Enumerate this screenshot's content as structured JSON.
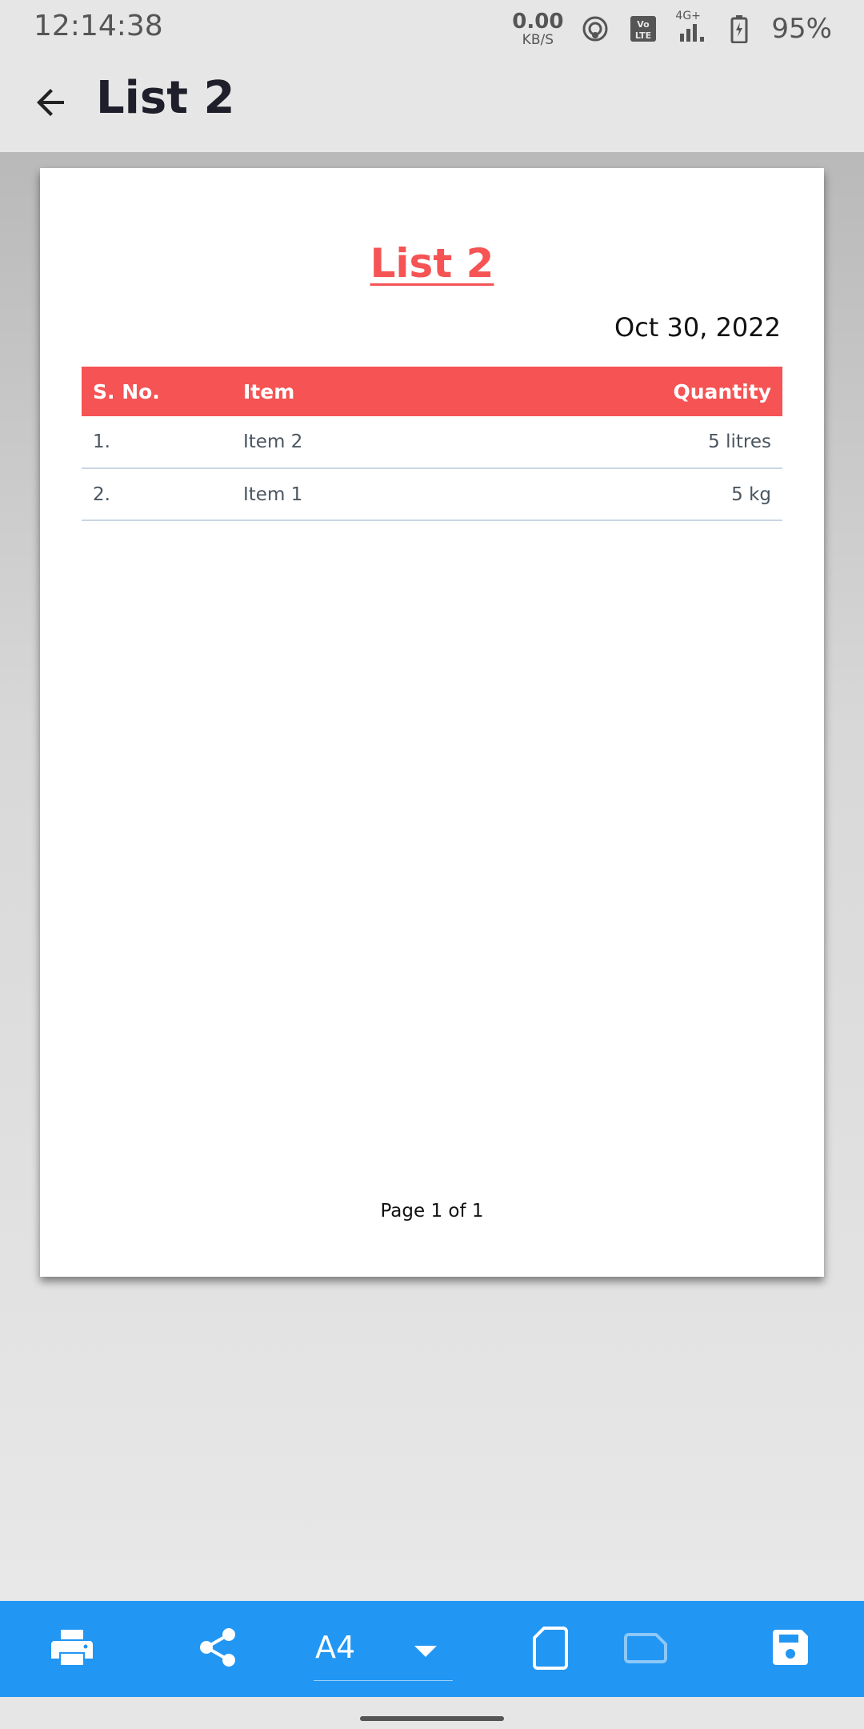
{
  "status_bar": {
    "time": "12:14:38",
    "net_speed_value": "0.00",
    "net_speed_unit": "KB/S",
    "network_label": "4G+",
    "battery": "95%",
    "icons": [
      "hotspot-icon",
      "volte-icon",
      "signal-icon",
      "battery-icon"
    ]
  },
  "app_bar": {
    "title": "List 2",
    "back_icon": "arrow-back-icon"
  },
  "document": {
    "title": "List 2",
    "date": "Oct 30, 2022",
    "accent_color": "#f55354",
    "columns": [
      "S. No.",
      "Item",
      "Quantity"
    ],
    "rows": [
      {
        "sno": "1.",
        "item": "Item 2",
        "quantity": "5 litres"
      },
      {
        "sno": "2.",
        "item": "Item 1",
        "quantity": "5 kg"
      }
    ],
    "footer": "Page 1 of 1"
  },
  "toolbar": {
    "background_color": "#2196f3",
    "page_size": "A4",
    "icons": [
      "print-icon",
      "share-icon",
      "dropdown-caret-icon",
      "portrait-orientation-icon",
      "landscape-orientation-icon",
      "save-icon"
    ]
  }
}
